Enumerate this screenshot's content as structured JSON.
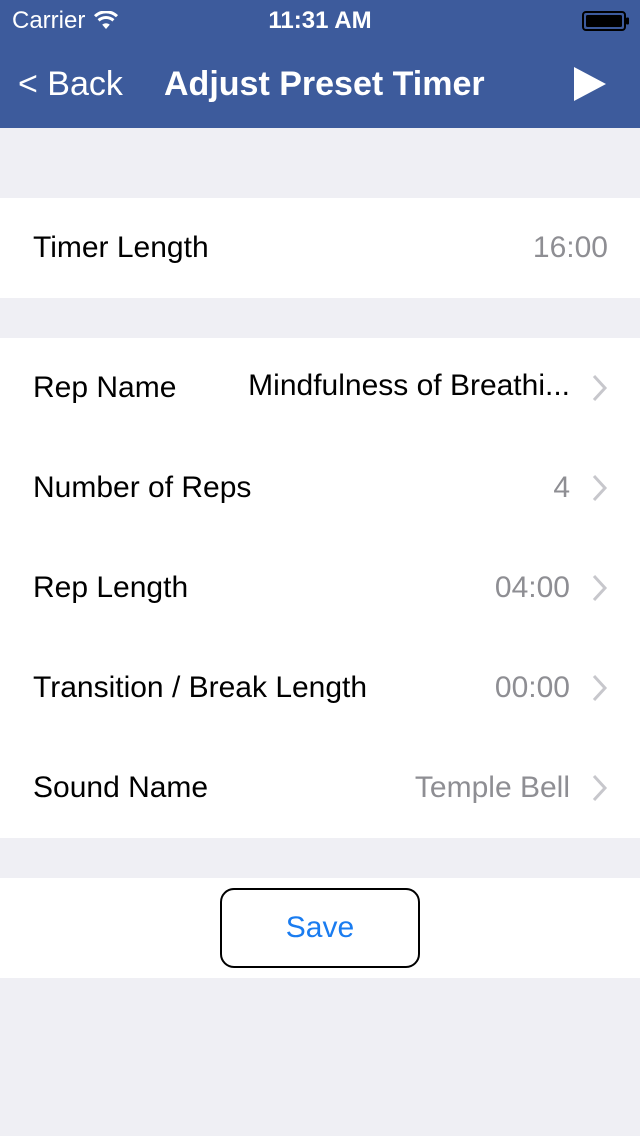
{
  "status_bar": {
    "carrier": "Carrier",
    "time": "11:31 AM",
    "wifi_icon": "wifi-icon",
    "battery_icon": "battery-full-icon"
  },
  "nav": {
    "back_label": "< Back",
    "title": "Adjust Preset Timer",
    "play_icon": "play-icon",
    "background_color": "#3d5b9c"
  },
  "timer": {
    "label": "Timer Length",
    "value": "16:00"
  },
  "settings": [
    {
      "label": "Rep Name",
      "value": "Mindfulness of Breathi..."
    },
    {
      "label": "Number of Reps",
      "value": "4"
    },
    {
      "label": "Rep Length",
      "value": "04:00"
    },
    {
      "label": "Transition / Break Length",
      "value": "00:00"
    },
    {
      "label": "Sound Name",
      "value": "Temple Bell"
    }
  ],
  "save_label": "Save",
  "colors": {
    "accent": "#1a7cf0",
    "secondary_text": "#8e8e93",
    "background": "#efeff4"
  }
}
